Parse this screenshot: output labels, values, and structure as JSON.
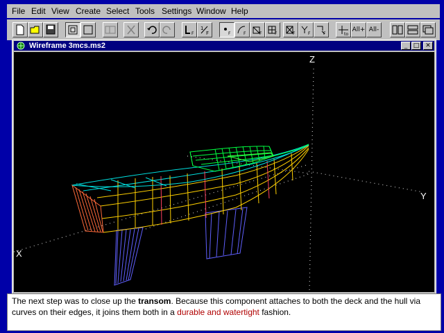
{
  "menu": {
    "file": "File",
    "edit": "Edit",
    "view": "View",
    "create": "Create",
    "select": "Select",
    "tools": "Tools",
    "settings": "Settings",
    "window": "Window",
    "help": "Help"
  },
  "toolbar": {
    "all_plus": "All+",
    "all_minus": "All-"
  },
  "document_window": {
    "title": "Wireframe 3mcs.ms2"
  },
  "viewport": {
    "axis_z": "Z",
    "axis_y": "Y",
    "axis_x": "X"
  },
  "caption": {
    "part1": "The next step was to close up the ",
    "bold": "transom",
    "part2": ". Because this component attaches to both the deck and the hull via curves on their edges, it joins them both in a ",
    "link": "durable and watertight",
    "part3": " fashion."
  },
  "colors": {
    "hull": "#ffd000",
    "deck": "#00e0e0",
    "transom": "#00ff40",
    "keel": "#6060ff",
    "station": "#ff4060"
  }
}
